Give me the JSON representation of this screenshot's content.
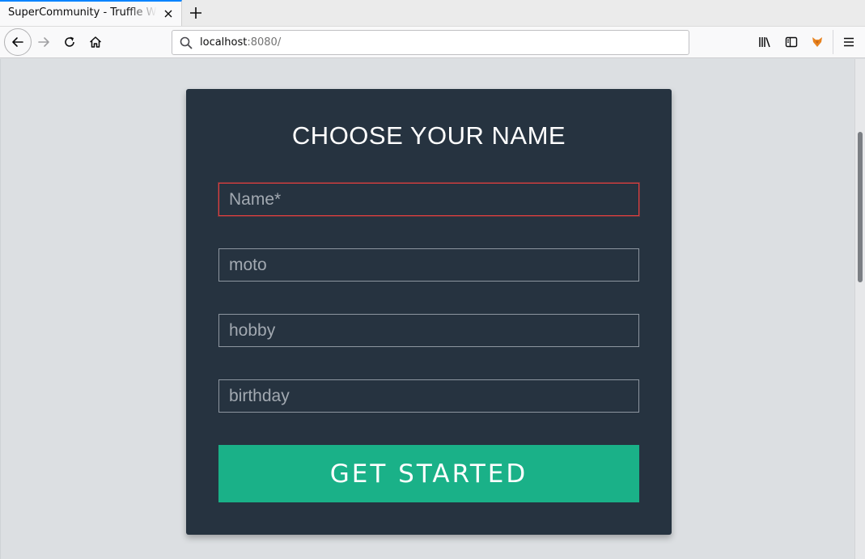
{
  "browser": {
    "tab": {
      "title": "SuperCommunity - Truffle Webpack"
    },
    "url": {
      "host": "localhost",
      "port": ":8080/"
    }
  },
  "form": {
    "title": "CHOOSE YOUR NAME",
    "fields": [
      {
        "placeholder": "Name*",
        "value": "",
        "state": "invalid"
      },
      {
        "placeholder": "moto",
        "value": ""
      },
      {
        "placeholder": "hobby",
        "value": ""
      },
      {
        "placeholder": "birthday",
        "value": ""
      }
    ],
    "submit_label": "GET STARTED"
  },
  "colors": {
    "card": "#263340",
    "accent": "#1ab188",
    "invalid_border": "#e03f3f",
    "page_bg": "#dcdfe2"
  },
  "icons": [
    "close-icon",
    "plus-icon",
    "arrow-left-icon",
    "arrow-right-icon",
    "reload-icon",
    "home-icon",
    "search-icon",
    "library-icon",
    "sidebar-icon",
    "fox-icon",
    "hamburger-menu-icon"
  ]
}
